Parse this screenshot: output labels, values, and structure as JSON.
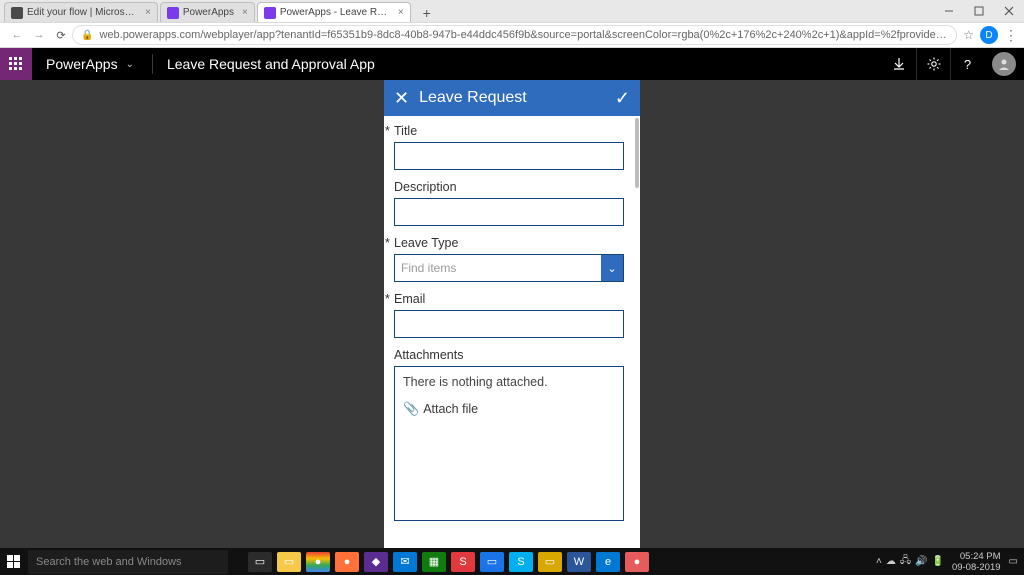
{
  "browser": {
    "tabs": [
      {
        "title": "Edit your flow | Microsoft Flow"
      },
      {
        "title": "PowerApps"
      },
      {
        "title": "PowerApps - Leave Request and"
      }
    ],
    "url": "web.powerapps.com/webplayer/app?tenantId=f65351b9-8dc8-40b8-947b-e44ddc456f9b&source=portal&screenColor=rgba(0%2c+176%2c+240%2c+1)&appId=%2fproviders%2fMicrosoft.PowerApps%2f...",
    "avatar_letter": "D"
  },
  "powerapps": {
    "brand": "PowerApps",
    "app_name": "Leave Request and Approval App"
  },
  "form": {
    "header_title": "Leave Request",
    "fields": {
      "title_label": "Title",
      "description_label": "Description",
      "leave_type_label": "Leave Type",
      "leave_type_placeholder": "Find items",
      "email_label": "Email",
      "attachments_label": "Attachments",
      "attachments_empty": "There is nothing attached.",
      "attach_file_label": "Attach file"
    }
  },
  "taskbar": {
    "search_placeholder": "Search the web and Windows",
    "time": "05:24 PM",
    "date": "09-08-2019"
  }
}
